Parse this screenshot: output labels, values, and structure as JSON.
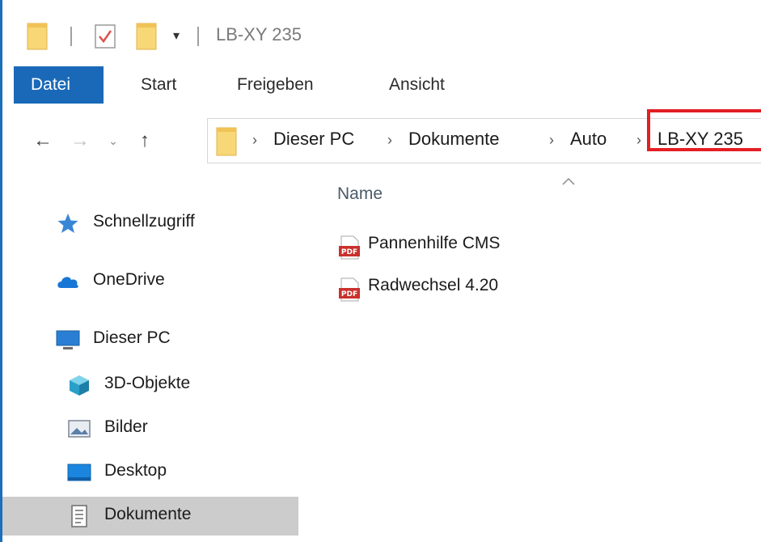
{
  "window": {
    "title": "LB-XY 235",
    "accent_color": "#1a69b8"
  },
  "quick_access_toolbar": {
    "icons": [
      "folder-icon",
      "properties-icon",
      "new-folder-icon",
      "customize-dropdown-icon"
    ],
    "dropdown_glyph": "▾"
  },
  "ribbon": {
    "tabs": [
      {
        "label": "Datei",
        "active": true
      },
      {
        "label": "Start"
      },
      {
        "label": "Freigeben"
      },
      {
        "label": "Ansicht"
      }
    ]
  },
  "navigation": {
    "back_glyph": "←",
    "forward_glyph": "→",
    "recent_glyph": "⌄",
    "up_glyph": "↑"
  },
  "address_bar": {
    "separator": "›",
    "breadcrumbs": [
      "Dieser PC",
      "Dokumente",
      "Auto",
      "LB-XY 235"
    ],
    "highlight_color": "#e31e24"
  },
  "content": {
    "column_header": "Name",
    "sort_direction": "ascending",
    "files": [
      {
        "name": "Pannenhilfe CMS",
        "icon": "pdf-icon"
      },
      {
        "name": "Radwechsel 4.20",
        "icon": "pdf-icon"
      }
    ]
  },
  "sidebar": {
    "items": [
      {
        "label": "Schnellzugriff",
        "icon": "star-icon"
      },
      {
        "label": "OneDrive",
        "icon": "cloud-icon"
      },
      {
        "label": "Dieser PC",
        "icon": "computer-icon"
      },
      {
        "label": "3D-Objekte",
        "icon": "cube-icon"
      },
      {
        "label": "Bilder",
        "icon": "pictures-icon"
      },
      {
        "label": "Desktop",
        "icon": "desktop-icon"
      },
      {
        "label": "Dokumente",
        "icon": "documents-icon",
        "selected": true
      }
    ]
  }
}
